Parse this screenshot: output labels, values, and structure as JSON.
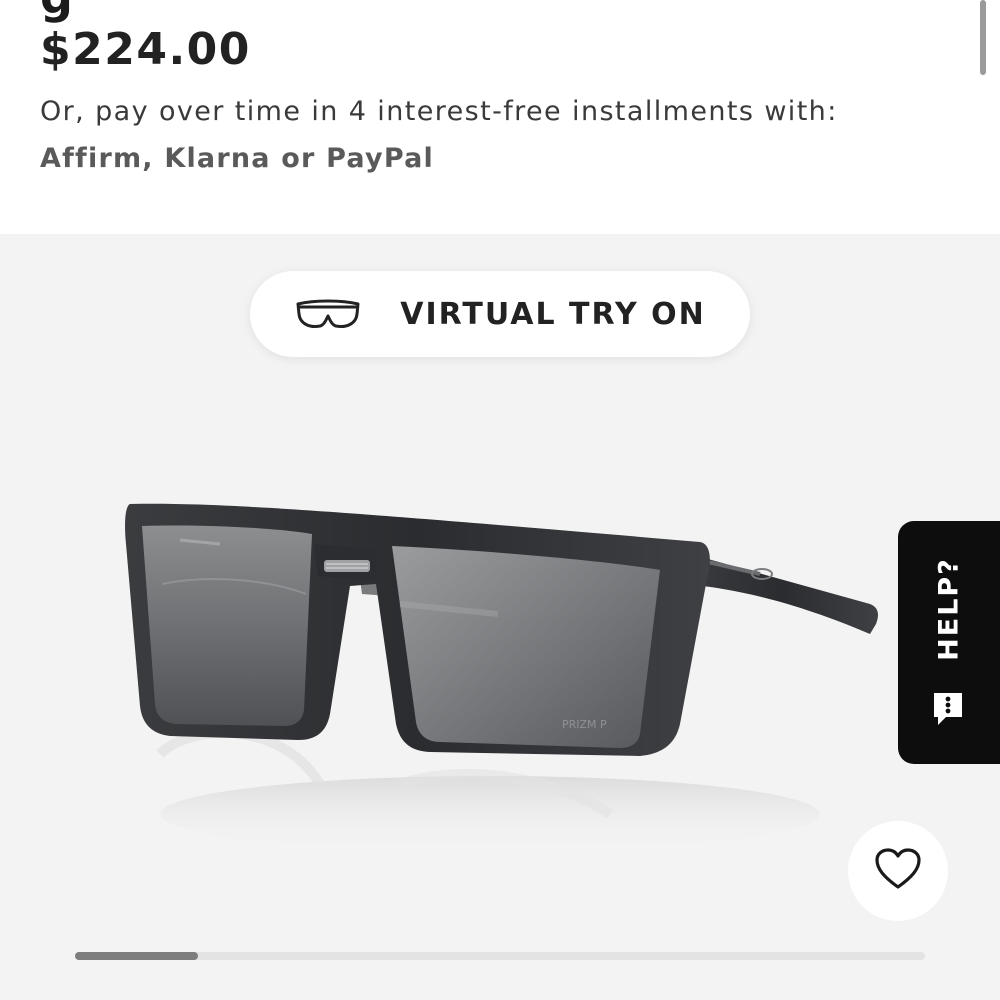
{
  "product": {
    "price": "$224.00",
    "installments_text": "Or, pay over time in 4 interest-free installments with:",
    "providers_text": "Affirm, Klarna or PayPal"
  },
  "gallery": {
    "virtual_try_on_label": "VIRTUAL TRY ON",
    "image_alt": "sunglasses",
    "lens_brand_mark": "PRIZM P",
    "carousel_progress": 0.145
  },
  "help": {
    "label": "HELP?",
    "icon": "chat-bubble-icon"
  },
  "favorite": {
    "icon": "heart-icon"
  },
  "colors": {
    "background": "#ffffff",
    "gallery_background": "#f3f3f3",
    "help_tab": "#0d0d0d",
    "text_primary": "#222222",
    "text_muted": "#5a5a5a"
  }
}
